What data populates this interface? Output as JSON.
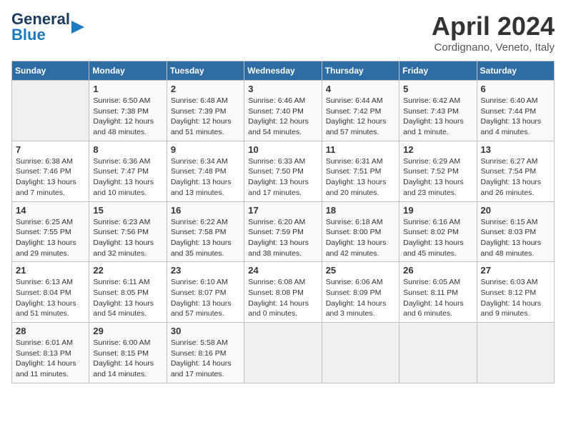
{
  "header": {
    "logo_line1": "General",
    "logo_line2": "Blue",
    "month": "April 2024",
    "location": "Cordignano, Veneto, Italy"
  },
  "days_of_week": [
    "Sunday",
    "Monday",
    "Tuesday",
    "Wednesday",
    "Thursday",
    "Friday",
    "Saturday"
  ],
  "weeks": [
    [
      {
        "day": "",
        "sunrise": "",
        "sunset": "",
        "daylight": ""
      },
      {
        "day": "1",
        "sunrise": "Sunrise: 6:50 AM",
        "sunset": "Sunset: 7:38 PM",
        "daylight": "Daylight: 12 hours and 48 minutes."
      },
      {
        "day": "2",
        "sunrise": "Sunrise: 6:48 AM",
        "sunset": "Sunset: 7:39 PM",
        "daylight": "Daylight: 12 hours and 51 minutes."
      },
      {
        "day": "3",
        "sunrise": "Sunrise: 6:46 AM",
        "sunset": "Sunset: 7:40 PM",
        "daylight": "Daylight: 12 hours and 54 minutes."
      },
      {
        "day": "4",
        "sunrise": "Sunrise: 6:44 AM",
        "sunset": "Sunset: 7:42 PM",
        "daylight": "Daylight: 12 hours and 57 minutes."
      },
      {
        "day": "5",
        "sunrise": "Sunrise: 6:42 AM",
        "sunset": "Sunset: 7:43 PM",
        "daylight": "Daylight: 13 hours and 1 minute."
      },
      {
        "day": "6",
        "sunrise": "Sunrise: 6:40 AM",
        "sunset": "Sunset: 7:44 PM",
        "daylight": "Daylight: 13 hours and 4 minutes."
      }
    ],
    [
      {
        "day": "7",
        "sunrise": "Sunrise: 6:38 AM",
        "sunset": "Sunset: 7:46 PM",
        "daylight": "Daylight: 13 hours and 7 minutes."
      },
      {
        "day": "8",
        "sunrise": "Sunrise: 6:36 AM",
        "sunset": "Sunset: 7:47 PM",
        "daylight": "Daylight: 13 hours and 10 minutes."
      },
      {
        "day": "9",
        "sunrise": "Sunrise: 6:34 AM",
        "sunset": "Sunset: 7:48 PM",
        "daylight": "Daylight: 13 hours and 13 minutes."
      },
      {
        "day": "10",
        "sunrise": "Sunrise: 6:33 AM",
        "sunset": "Sunset: 7:50 PM",
        "daylight": "Daylight: 13 hours and 17 minutes."
      },
      {
        "day": "11",
        "sunrise": "Sunrise: 6:31 AM",
        "sunset": "Sunset: 7:51 PM",
        "daylight": "Daylight: 13 hours and 20 minutes."
      },
      {
        "day": "12",
        "sunrise": "Sunrise: 6:29 AM",
        "sunset": "Sunset: 7:52 PM",
        "daylight": "Daylight: 13 hours and 23 minutes."
      },
      {
        "day": "13",
        "sunrise": "Sunrise: 6:27 AM",
        "sunset": "Sunset: 7:54 PM",
        "daylight": "Daylight: 13 hours and 26 minutes."
      }
    ],
    [
      {
        "day": "14",
        "sunrise": "Sunrise: 6:25 AM",
        "sunset": "Sunset: 7:55 PM",
        "daylight": "Daylight: 13 hours and 29 minutes."
      },
      {
        "day": "15",
        "sunrise": "Sunrise: 6:23 AM",
        "sunset": "Sunset: 7:56 PM",
        "daylight": "Daylight: 13 hours and 32 minutes."
      },
      {
        "day": "16",
        "sunrise": "Sunrise: 6:22 AM",
        "sunset": "Sunset: 7:58 PM",
        "daylight": "Daylight: 13 hours and 35 minutes."
      },
      {
        "day": "17",
        "sunrise": "Sunrise: 6:20 AM",
        "sunset": "Sunset: 7:59 PM",
        "daylight": "Daylight: 13 hours and 38 minutes."
      },
      {
        "day": "18",
        "sunrise": "Sunrise: 6:18 AM",
        "sunset": "Sunset: 8:00 PM",
        "daylight": "Daylight: 13 hours and 42 minutes."
      },
      {
        "day": "19",
        "sunrise": "Sunrise: 6:16 AM",
        "sunset": "Sunset: 8:02 PM",
        "daylight": "Daylight: 13 hours and 45 minutes."
      },
      {
        "day": "20",
        "sunrise": "Sunrise: 6:15 AM",
        "sunset": "Sunset: 8:03 PM",
        "daylight": "Daylight: 13 hours and 48 minutes."
      }
    ],
    [
      {
        "day": "21",
        "sunrise": "Sunrise: 6:13 AM",
        "sunset": "Sunset: 8:04 PM",
        "daylight": "Daylight: 13 hours and 51 minutes."
      },
      {
        "day": "22",
        "sunrise": "Sunrise: 6:11 AM",
        "sunset": "Sunset: 8:05 PM",
        "daylight": "Daylight: 13 hours and 54 minutes."
      },
      {
        "day": "23",
        "sunrise": "Sunrise: 6:10 AM",
        "sunset": "Sunset: 8:07 PM",
        "daylight": "Daylight: 13 hours and 57 minutes."
      },
      {
        "day": "24",
        "sunrise": "Sunrise: 6:08 AM",
        "sunset": "Sunset: 8:08 PM",
        "daylight": "Daylight: 14 hours and 0 minutes."
      },
      {
        "day": "25",
        "sunrise": "Sunrise: 6:06 AM",
        "sunset": "Sunset: 8:09 PM",
        "daylight": "Daylight: 14 hours and 3 minutes."
      },
      {
        "day": "26",
        "sunrise": "Sunrise: 6:05 AM",
        "sunset": "Sunset: 8:11 PM",
        "daylight": "Daylight: 14 hours and 6 minutes."
      },
      {
        "day": "27",
        "sunrise": "Sunrise: 6:03 AM",
        "sunset": "Sunset: 8:12 PM",
        "daylight": "Daylight: 14 hours and 9 minutes."
      }
    ],
    [
      {
        "day": "28",
        "sunrise": "Sunrise: 6:01 AM",
        "sunset": "Sunset: 8:13 PM",
        "daylight": "Daylight: 14 hours and 11 minutes."
      },
      {
        "day": "29",
        "sunrise": "Sunrise: 6:00 AM",
        "sunset": "Sunset: 8:15 PM",
        "daylight": "Daylight: 14 hours and 14 minutes."
      },
      {
        "day": "30",
        "sunrise": "Sunrise: 5:58 AM",
        "sunset": "Sunset: 8:16 PM",
        "daylight": "Daylight: 14 hours and 17 minutes."
      },
      {
        "day": "",
        "sunrise": "",
        "sunset": "",
        "daylight": ""
      },
      {
        "day": "",
        "sunrise": "",
        "sunset": "",
        "daylight": ""
      },
      {
        "day": "",
        "sunrise": "",
        "sunset": "",
        "daylight": ""
      },
      {
        "day": "",
        "sunrise": "",
        "sunset": "",
        "daylight": ""
      }
    ]
  ]
}
